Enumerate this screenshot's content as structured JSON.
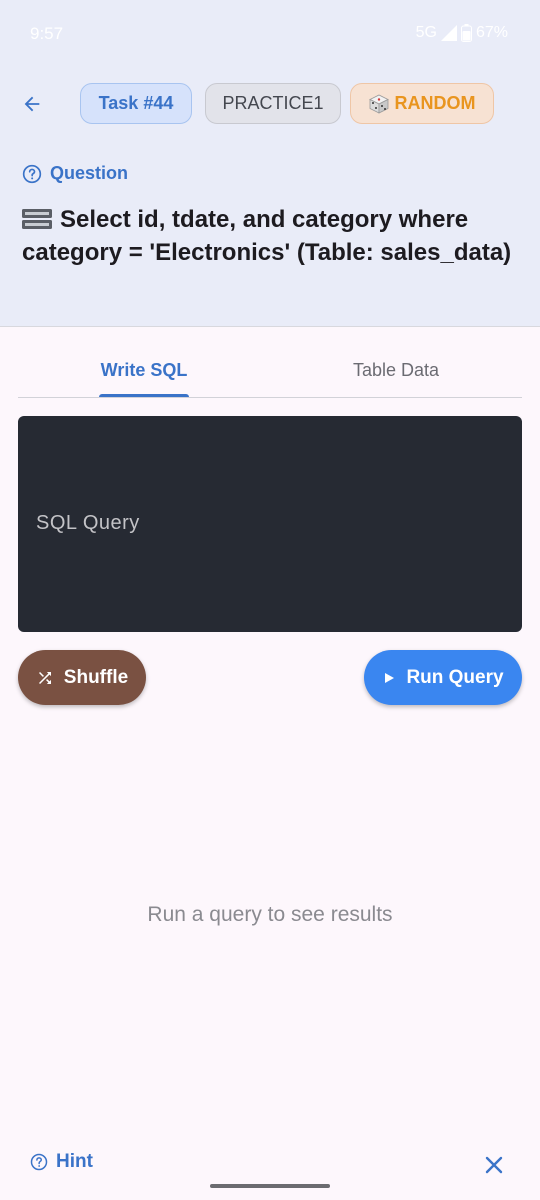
{
  "status_bar": {
    "time": "9:57",
    "network": "5G",
    "battery": "67%"
  },
  "header": {
    "back_icon": "arrow-left-icon",
    "chips": {
      "task": "Task #44",
      "practice": "PRACTICE1",
      "random": "RANDOM",
      "random_icon": "dice-icon"
    }
  },
  "question": {
    "label": "Question",
    "label_icon": "help-circle-icon",
    "text": "Select id, tdate, and category where category = 'Electronics' (Table: sales_data)",
    "icon": "storage-icon"
  },
  "tabs": [
    {
      "label": "Write SQL",
      "active": true
    },
    {
      "label": "Table Data",
      "active": false
    }
  ],
  "editor": {
    "placeholder": "SQL Query",
    "value": ""
  },
  "buttons": {
    "shuffle": "Shuffle",
    "run": "Run Query"
  },
  "results": {
    "empty_text": "Run a query to see results"
  },
  "footer": {
    "hint": "Hint"
  },
  "colors": {
    "accent": "#3a73c8",
    "run_button": "#3a86f0",
    "shuffle_button": "#7a5142",
    "editor_bg": "#262a33",
    "random_text": "#e9951f"
  }
}
